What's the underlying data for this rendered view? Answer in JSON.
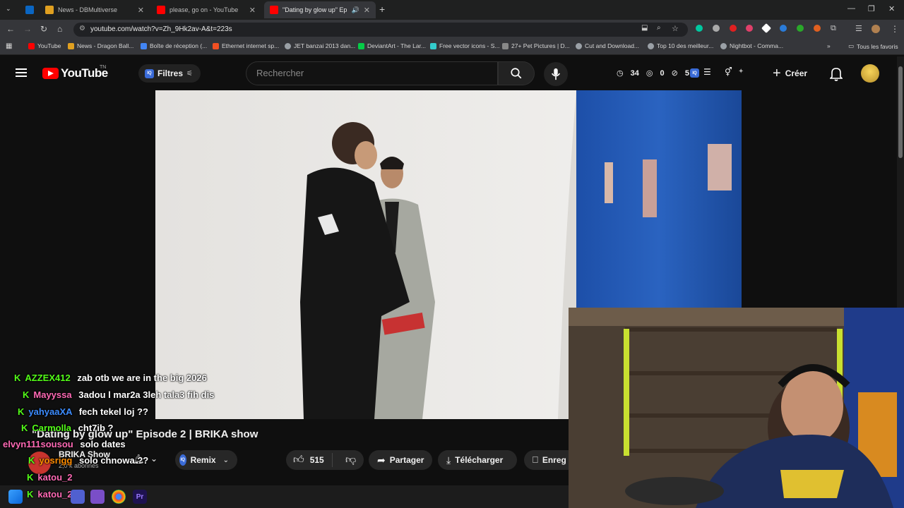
{
  "browser": {
    "tabs": [
      {
        "title": "",
        "icon": "linkedin-icon",
        "color": "#0a66c2"
      },
      {
        "title": "News - DBMultiverse",
        "icon": "dbmultiverse-icon",
        "color": "#e0a020"
      },
      {
        "title": "please, go on - YouTube",
        "icon": "youtube-icon",
        "color": "#ff0000"
      },
      {
        "title": "\"Dating by glow up\" Episod",
        "icon": "youtube-icon",
        "color": "#ff0000"
      }
    ],
    "new_tab": "+",
    "url": "youtube.com/watch?v=Zh_9Hk2av-A&t=223s",
    "bookmarks": [
      {
        "label": "YouTube",
        "color": "#ff0000"
      },
      {
        "label": "News - Dragon Ball...",
        "color": "#e0a020"
      },
      {
        "label": "Boîte de réception (...",
        "color": "#4285f4"
      },
      {
        "label": "Ethernet internet sp...",
        "color": "#f25022"
      },
      {
        "label": "JET banzai 2013 dan...",
        "color": "#9aa0a6"
      },
      {
        "label": "DeviantArt - The Lar...",
        "color": "#05cc47"
      },
      {
        "label": "Free vector icons - S...",
        "color": "#33cccc"
      },
      {
        "label": "27+ Pet Pictures | D...",
        "color": "#888888"
      },
      {
        "label": "Cut and Download...",
        "color": "#9aa0a6"
      },
      {
        "label": "Top 10 des meilleur...",
        "color": "#9aa0a6"
      },
      {
        "label": "Nightbot - Comma...",
        "color": "#9aa0a6"
      }
    ],
    "bookmarks_all": "Tous les favoris"
  },
  "youtube": {
    "logo_text": "YouTube",
    "country_code": "TN",
    "filters_label": "Filtres",
    "iq_badge": "IQ",
    "search_placeholder": "Rechercher",
    "stats": {
      "watch_later": "34",
      "views": "0",
      "hidden": "5"
    },
    "create_label": "Créer"
  },
  "video": {
    "title": "\"Dating by glow up\" Episode 2 | BRIKA show",
    "channel": "BRIKA Show",
    "subscribers": "2,0 k abonnés",
    "remix_label": "Remix",
    "likes": "515",
    "share_label": "Partager",
    "download_label": "Télécharger",
    "save_label": "Enreg"
  },
  "chat": [
    {
      "user": "AZZEX412",
      "msg": "zab otb we are in the big 2026",
      "color": "#53fc18",
      "badge": true
    },
    {
      "user": "Mayyssa",
      "msg": "3adou l mar2a 3leh tala3 fih dis",
      "color": "#ff69b4",
      "badge": true
    },
    {
      "user": "yahyaaXA",
      "msg": "fech tekel loj ??",
      "color": "#1e90ff",
      "badge": true
    },
    {
      "user": "Carmolla",
      "msg": "cht7ib ?",
      "color": "#53fc18",
      "badge": true
    },
    {
      "user": "elvyn111sousou",
      "msg": "solo dates",
      "color": "#ff69b4",
      "badge": false
    },
    {
      "user": "yosrigg",
      "msg": "solo chnowa ??",
      "color": "#ff8c00",
      "badge": true
    },
    {
      "user": "katou_2",
      "msg": "",
      "color": "#ff69b4",
      "badge": true
    },
    {
      "user": "katou_2",
      "msg": "",
      "color": "#ff69b4",
      "badge": true
    }
  ]
}
